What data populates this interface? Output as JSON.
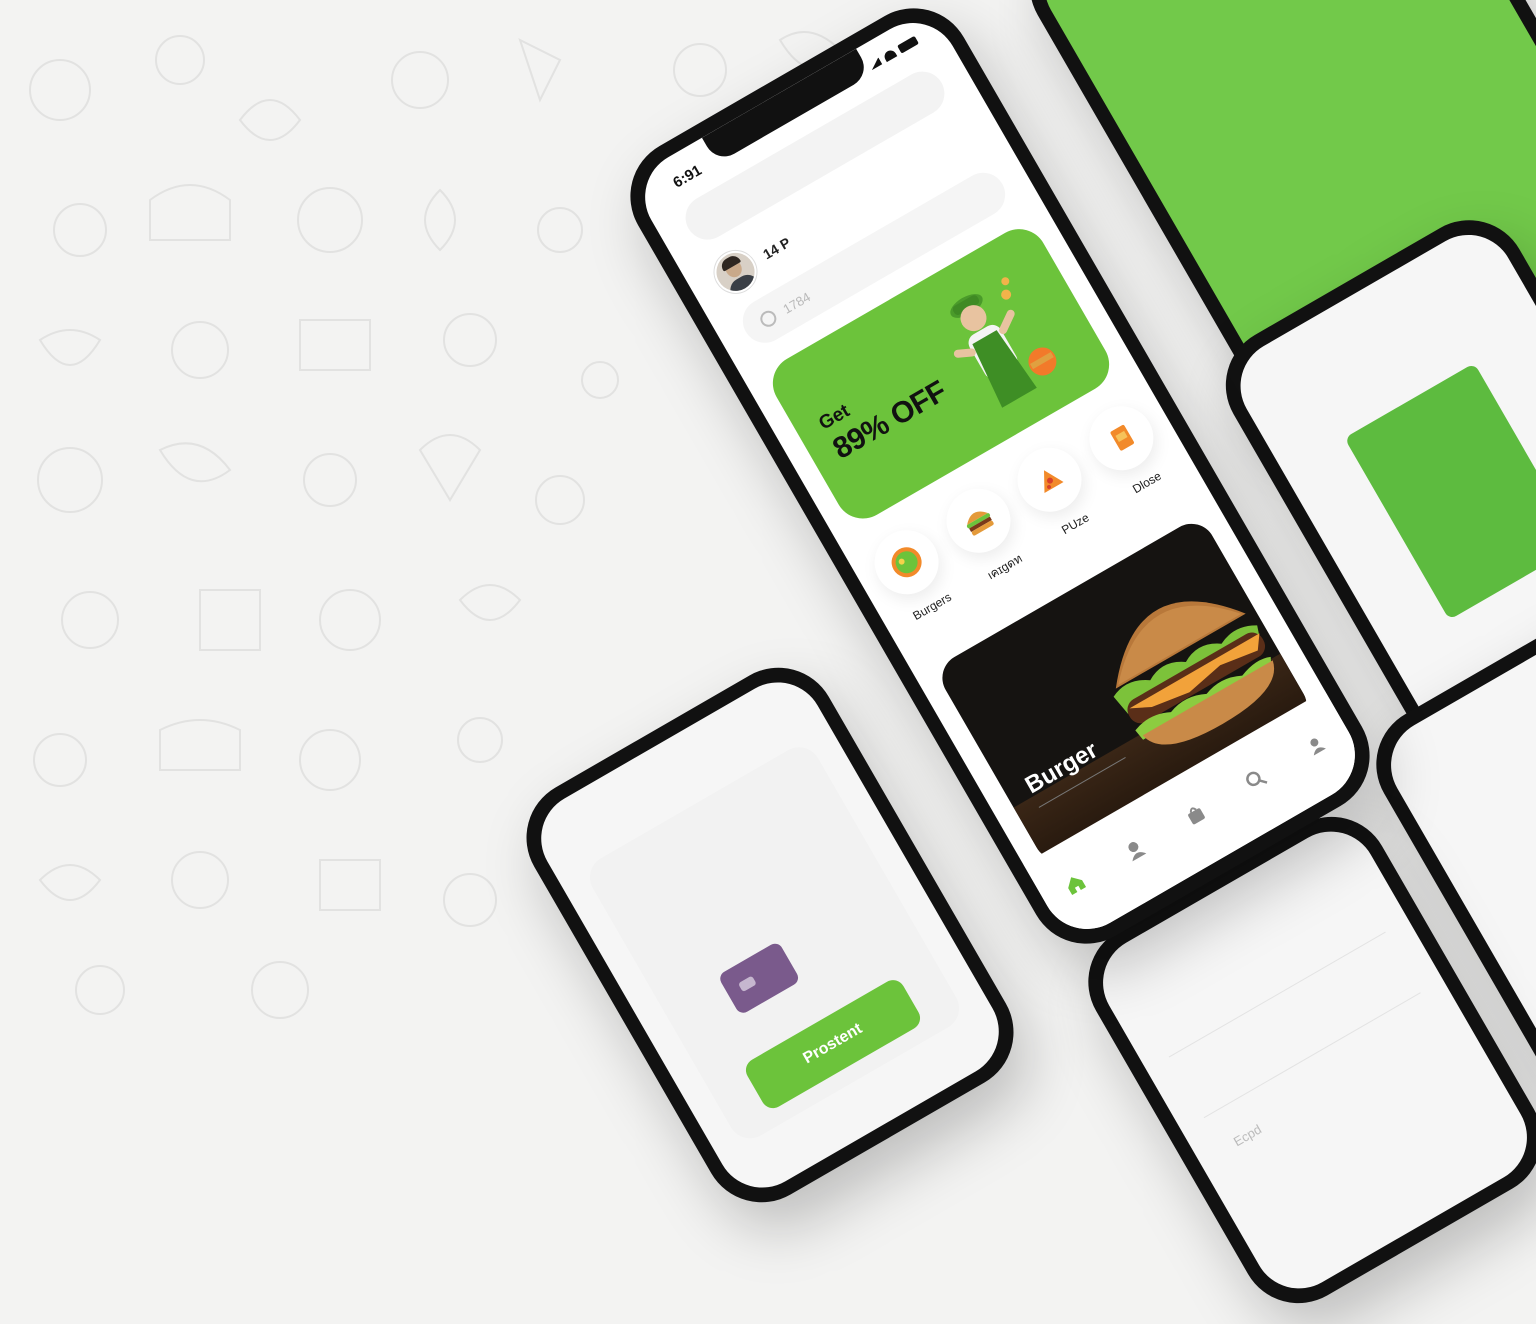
{
  "colors": {
    "accent_green": "#6cc33b",
    "background": "#f3f3f2",
    "phone_frame": "#111111",
    "card_purple": "#7a5a8c"
  },
  "main_phone": {
    "status": {
      "time": "6:91",
      "icons": [
        "signal-icon",
        "wifi-icon",
        "battery-icon"
      ]
    },
    "profile": {
      "name": "14 P"
    },
    "search": {
      "placeholder": "1784",
      "icon": "search-icon"
    },
    "promo": {
      "line1": "Get",
      "line2": "89% OFF"
    },
    "categories": [
      {
        "label": "Burgers",
        "icon": "salad-icon"
      },
      {
        "label": "ıคɪgดท",
        "icon": "burger-icon"
      },
      {
        "label": "PUze",
        "icon": "pizza-icon"
      },
      {
        "label": "Dlose",
        "icon": "drink-box-icon"
      }
    ],
    "featured": {
      "title": "Burger"
    },
    "tabbar": [
      "home-icon",
      "profile-icon",
      "bag-icon",
      "search-icon",
      "account-icon"
    ]
  },
  "bottom_left_phone": {
    "button_label": "Prostent",
    "card_icon": "credit-card-icon"
  },
  "bottom_right_phone": {
    "placeholder": "Ecpd"
  }
}
